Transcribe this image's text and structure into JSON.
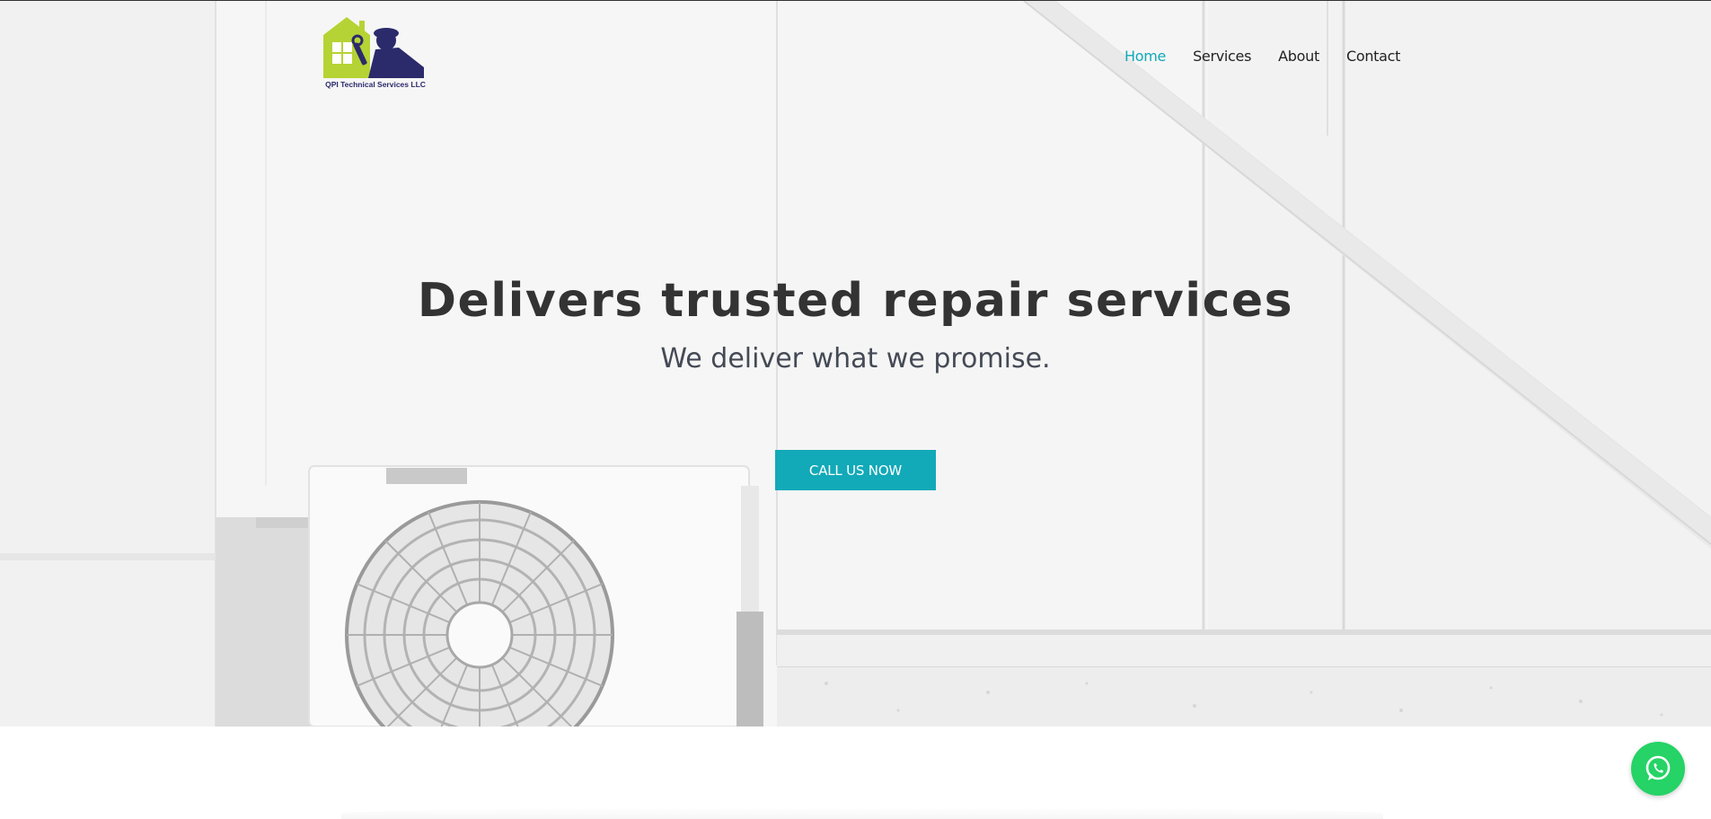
{
  "brand": {
    "name": "QPI Technical Services LLC",
    "colors": {
      "green": "#b5d334",
      "navy": "#2b2a6b"
    }
  },
  "nav": {
    "items": [
      {
        "label": "Home",
        "active": true
      },
      {
        "label": "Services",
        "active": false
      },
      {
        "label": "About",
        "active": false
      },
      {
        "label": "Contact",
        "active": false
      }
    ]
  },
  "hero": {
    "title": "Delivers trusted repair services",
    "subtitle": "We deliver what we promise.",
    "cta_label": "CALL US NOW"
  },
  "floating": {
    "whatsapp_icon": "whatsapp-icon"
  },
  "theme": {
    "accent": "#12a9b8",
    "text_dark": "#333333",
    "whatsapp_green": "#25d366"
  }
}
